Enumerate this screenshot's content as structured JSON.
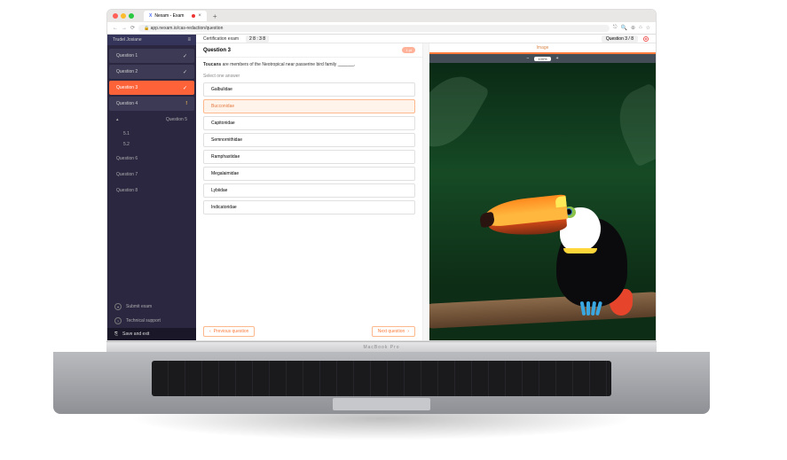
{
  "browser": {
    "tab_title": "Nexam - Exam",
    "url": "app.nexam.io/cas-redaction/question"
  },
  "sidebar": {
    "user": "Trudel Josiane",
    "q1": "Question 1",
    "q2": "Question 2",
    "q3": "Question 3",
    "q4": "Question 4",
    "q5": "Question 5",
    "q5a": "5.1",
    "q5b": "5.2",
    "q6": "Question 6",
    "q7": "Question 7",
    "q8": "Question 8",
    "submit": "Submit exam",
    "support": "Technical support",
    "save": "Save and exit"
  },
  "top": {
    "title": "Certification exam",
    "time": "2 8 : 3 8",
    "counter": "Question 3 / 8"
  },
  "question": {
    "heading": "Question 3",
    "points": "1 pt",
    "subject": "Toucans",
    "rest": " are members of the Neotropical near passerine bird family ",
    "blank": "__________",
    "select": "Select one answer",
    "o1": "Galbulidae",
    "o2": "Bucconidae",
    "o3": "Capitonidae",
    "o4": "Semnornithidae",
    "o5": "Ramphastidae",
    "o6": "Megalaimidae",
    "o7": "Lybiidae",
    "o8": "Indicatoridae",
    "prev": "Previous question",
    "next": "Next question"
  },
  "image": {
    "tab": "Image",
    "zoom": "100%"
  },
  "mac": "MacBook Pro"
}
